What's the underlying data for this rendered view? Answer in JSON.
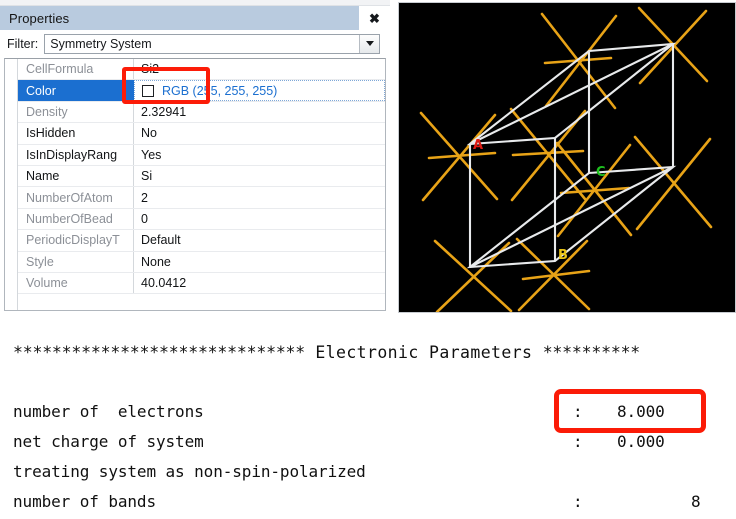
{
  "window": {
    "ghost_left": "",
    "ghost_right": ""
  },
  "properties_panel": {
    "title": "Properties",
    "close_icon": "close-icon",
    "filter": {
      "label": "Filter:",
      "value": "Symmetry System",
      "arrow_icon": "chevron-down-icon"
    },
    "rows": [
      {
        "name": "CellFormula",
        "value": "Si2",
        "editable": false,
        "selected": false,
        "type": "text"
      },
      {
        "name": "Color",
        "value": "RGB (255, 255, 255)",
        "editable": true,
        "selected": true,
        "type": "color",
        "swatch": "#ffffff"
      },
      {
        "name": "Density",
        "value": "2.32941",
        "editable": false,
        "selected": false,
        "type": "text"
      },
      {
        "name": "IsHidden",
        "value": "No",
        "editable": true,
        "selected": false,
        "type": "text"
      },
      {
        "name": "IsInDisplayRang",
        "value": "Yes",
        "editable": true,
        "selected": false,
        "type": "text"
      },
      {
        "name": "Name",
        "value": "Si",
        "editable": true,
        "selected": false,
        "type": "text"
      },
      {
        "name": "NumberOfAtom",
        "value": "2",
        "editable": false,
        "selected": false,
        "type": "text"
      },
      {
        "name": "NumberOfBead",
        "value": "0",
        "editable": false,
        "selected": false,
        "type": "text"
      },
      {
        "name": "PeriodicDisplayT",
        "value": "Default",
        "editable": false,
        "selected": false,
        "type": "text"
      },
      {
        "name": "Style",
        "value": "None",
        "editable": false,
        "selected": false,
        "type": "text"
      },
      {
        "name": "Volume",
        "value": "40.0412",
        "editable": false,
        "selected": false,
        "type": "text"
      }
    ]
  },
  "structure_viewer": {
    "background": "#000000",
    "atom_color": "#e8a317",
    "cell_edge_color": "#e8eaec",
    "axis_labels": [
      {
        "label": "A",
        "color": "#e01a12"
      },
      {
        "label": "B",
        "color": "#e8c317"
      },
      {
        "label": "C",
        "color": "#1fc21f"
      }
    ]
  },
  "console": {
    "header_stars_left": "******************************",
    "header_title": " Electronic Parameters ",
    "header_stars_right": "**********",
    "lines": [
      {
        "text": "number of  electrons",
        "colon": ":",
        "value": "8.000"
      },
      {
        "text": "net charge of system",
        "colon": ":",
        "value": "0.000"
      },
      {
        "text": "treating system as non-spin-polarized",
        "colon": "",
        "value": ""
      },
      {
        "text": "number of bands",
        "colon": ":",
        "value": "8"
      }
    ]
  },
  "annotations": {
    "cellformula_box_color": "#fc1c08",
    "electrons_box_color": "#fb1b07"
  }
}
